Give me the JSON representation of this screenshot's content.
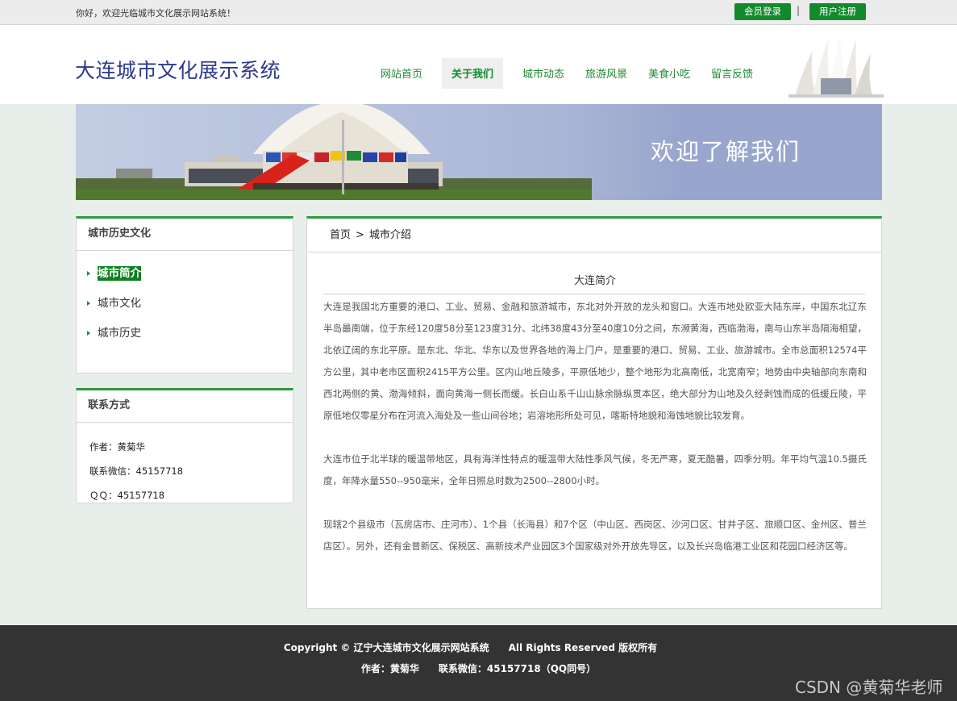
{
  "topbar": {
    "welcome": "你好，欢迎光临城市文化展示网站系统！",
    "login_label": "会员登录",
    "separator": "|",
    "register_label": "用户注册"
  },
  "header": {
    "site_title": "大连城市文化展示系统",
    "nav": [
      {
        "label": "网站首页",
        "active": false
      },
      {
        "label": "关于我们",
        "active": true
      },
      {
        "label": "城市动态",
        "active": false
      },
      {
        "label": "旅游风景",
        "active": false
      },
      {
        "label": "美食小吃",
        "active": false
      },
      {
        "label": "留言反馈",
        "active": false
      }
    ]
  },
  "banner": {
    "title": "欢迎了解我们",
    "colors": {
      "sky": "#a5b3d6",
      "right_panel": "#98a6cd"
    }
  },
  "sidebar": {
    "history": {
      "heading": "城市历史文化",
      "items": [
        {
          "label": "城市简介",
          "active": true
        },
        {
          "label": "城市文化",
          "active": false
        },
        {
          "label": "城市历史",
          "active": false
        }
      ]
    },
    "contact": {
      "heading": "联系方式",
      "author": "作者：黄菊华",
      "wechat": "联系微信：45157718",
      "qq": "ＱＱ：45157718"
    }
  },
  "main": {
    "breadcrumb": {
      "home": "首页",
      "separator": ">",
      "current": "城市介绍"
    },
    "article_title": "大连简介",
    "paragraphs": [
      " 大连是我国北方重要的港口、工业、贸易、金融和旅游城市，东北对外开放的龙头和窗口。大连市地处欧亚大陆东岸，中国东北辽东半岛最南端，位于东经120度58分至123度31分、北纬38度43分至40度10分之间，东濒黄海，西临渤海，南与山东半岛隔海相望，北依辽阔的东北平原。是东北、华北、华东以及世界各地的海上门户，是重要的港口、贸易、工业、旅游城市。全市总面积12574平方公里，其中老市区面积2415平方公里。区内山地丘陵多，平原低地少，整个地形为北高南低，北宽南窄；地势由中央轴部向东南和西北两侧的黄、渤海倾斜，面向黄海一侧长而缓。长白山系千山山脉余脉纵贯本区，绝大部分为山地及久经剥蚀而成的低缓丘陵，平原低地仅零星分布在河流入海处及一些山间谷地；岩溶地形所处可见，喀斯特地貌和海蚀地貌比较发育。",
      "大连市位于北半球的暖温带地区，具有海洋性特点的暖温带大陆性季风气候，冬无严寒，夏无酷暑，四季分明。年平均气温10.5摄氏度，年降水量550--950毫米，全年日照总时数为2500--2800小时。",
      "现辖2个县级市（瓦房店市、庄河市）、1个县（长海县）和7个区（中山区、西岗区、沙河口区、甘井子区、旅顺口区、金州区、普兰店区）。另外，还有金普新区、保税区、高新技术产业园区3个国家级对外开放先导区，以及长兴岛临港工业区和花园口经济区等。"
    ]
  },
  "footer": {
    "copyright": "Copyright © 辽宁大连城市文化展示网站系统　　All Rights Reserved 版权所有",
    "contact": "作者：黄菊华　　联系微信：45157718（QQ同号）",
    "watermark": "CSDN @黄菊华老师"
  },
  "theme": {
    "accent_green": "#128a2c",
    "footer_bg": "#333333",
    "page_bg": "#e8efea"
  }
}
